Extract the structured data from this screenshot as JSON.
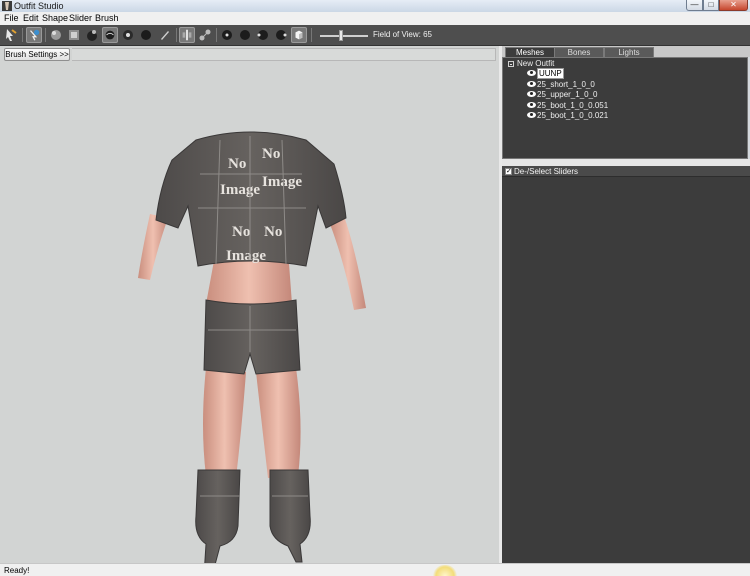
{
  "window": {
    "title": "Outfit Studio",
    "controls": {
      "minimize": "—",
      "maximize": "□",
      "close": "✕"
    }
  },
  "menu": [
    "File",
    "Edit",
    "Shape",
    "Slider",
    "Brush"
  ],
  "toolbar": {
    "tools": [
      "select-tool-icon",
      "mask-brush-icon",
      "inflate-brush-icon",
      "deflate-brush-icon",
      "move-brush-icon",
      "smooth-brush-icon",
      "undiff-brush-icon",
      "weight-brush-icon",
      "color-brush-icon",
      "pen-icon"
    ],
    "view_tools": [
      "mirror-icon",
      "connected-icon",
      "front-view-icon",
      "back-view-icon",
      "left-view-icon",
      "right-view-icon",
      "perspective-icon"
    ],
    "fov": {
      "label": "Field of View: 65",
      "value": 65
    }
  },
  "viewport": {
    "brush_settings": "Brush Settings >>",
    "background": "#d2d4d3",
    "model": {
      "outfit_color": "#5d5a58",
      "texture_text": [
        "No",
        "Image"
      ],
      "skin": "#e6b3a3"
    }
  },
  "tabs": [
    "Meshes",
    "Bones",
    "Lights"
  ],
  "meshes": {
    "root": "New Outfit",
    "items": [
      {
        "name": "UUNP",
        "selected": true
      },
      {
        "name": "25_short_1_0_0",
        "selected": false
      },
      {
        "name": "25_upper_1_0_0",
        "selected": false
      },
      {
        "name": "25_boot_1_0_0.051",
        "selected": false
      },
      {
        "name": "25_boot_1_0_0.021",
        "selected": false
      }
    ]
  },
  "sliders": {
    "toggle_label": "De-/Select Sliders",
    "checked": true
  },
  "status": "Ready!"
}
